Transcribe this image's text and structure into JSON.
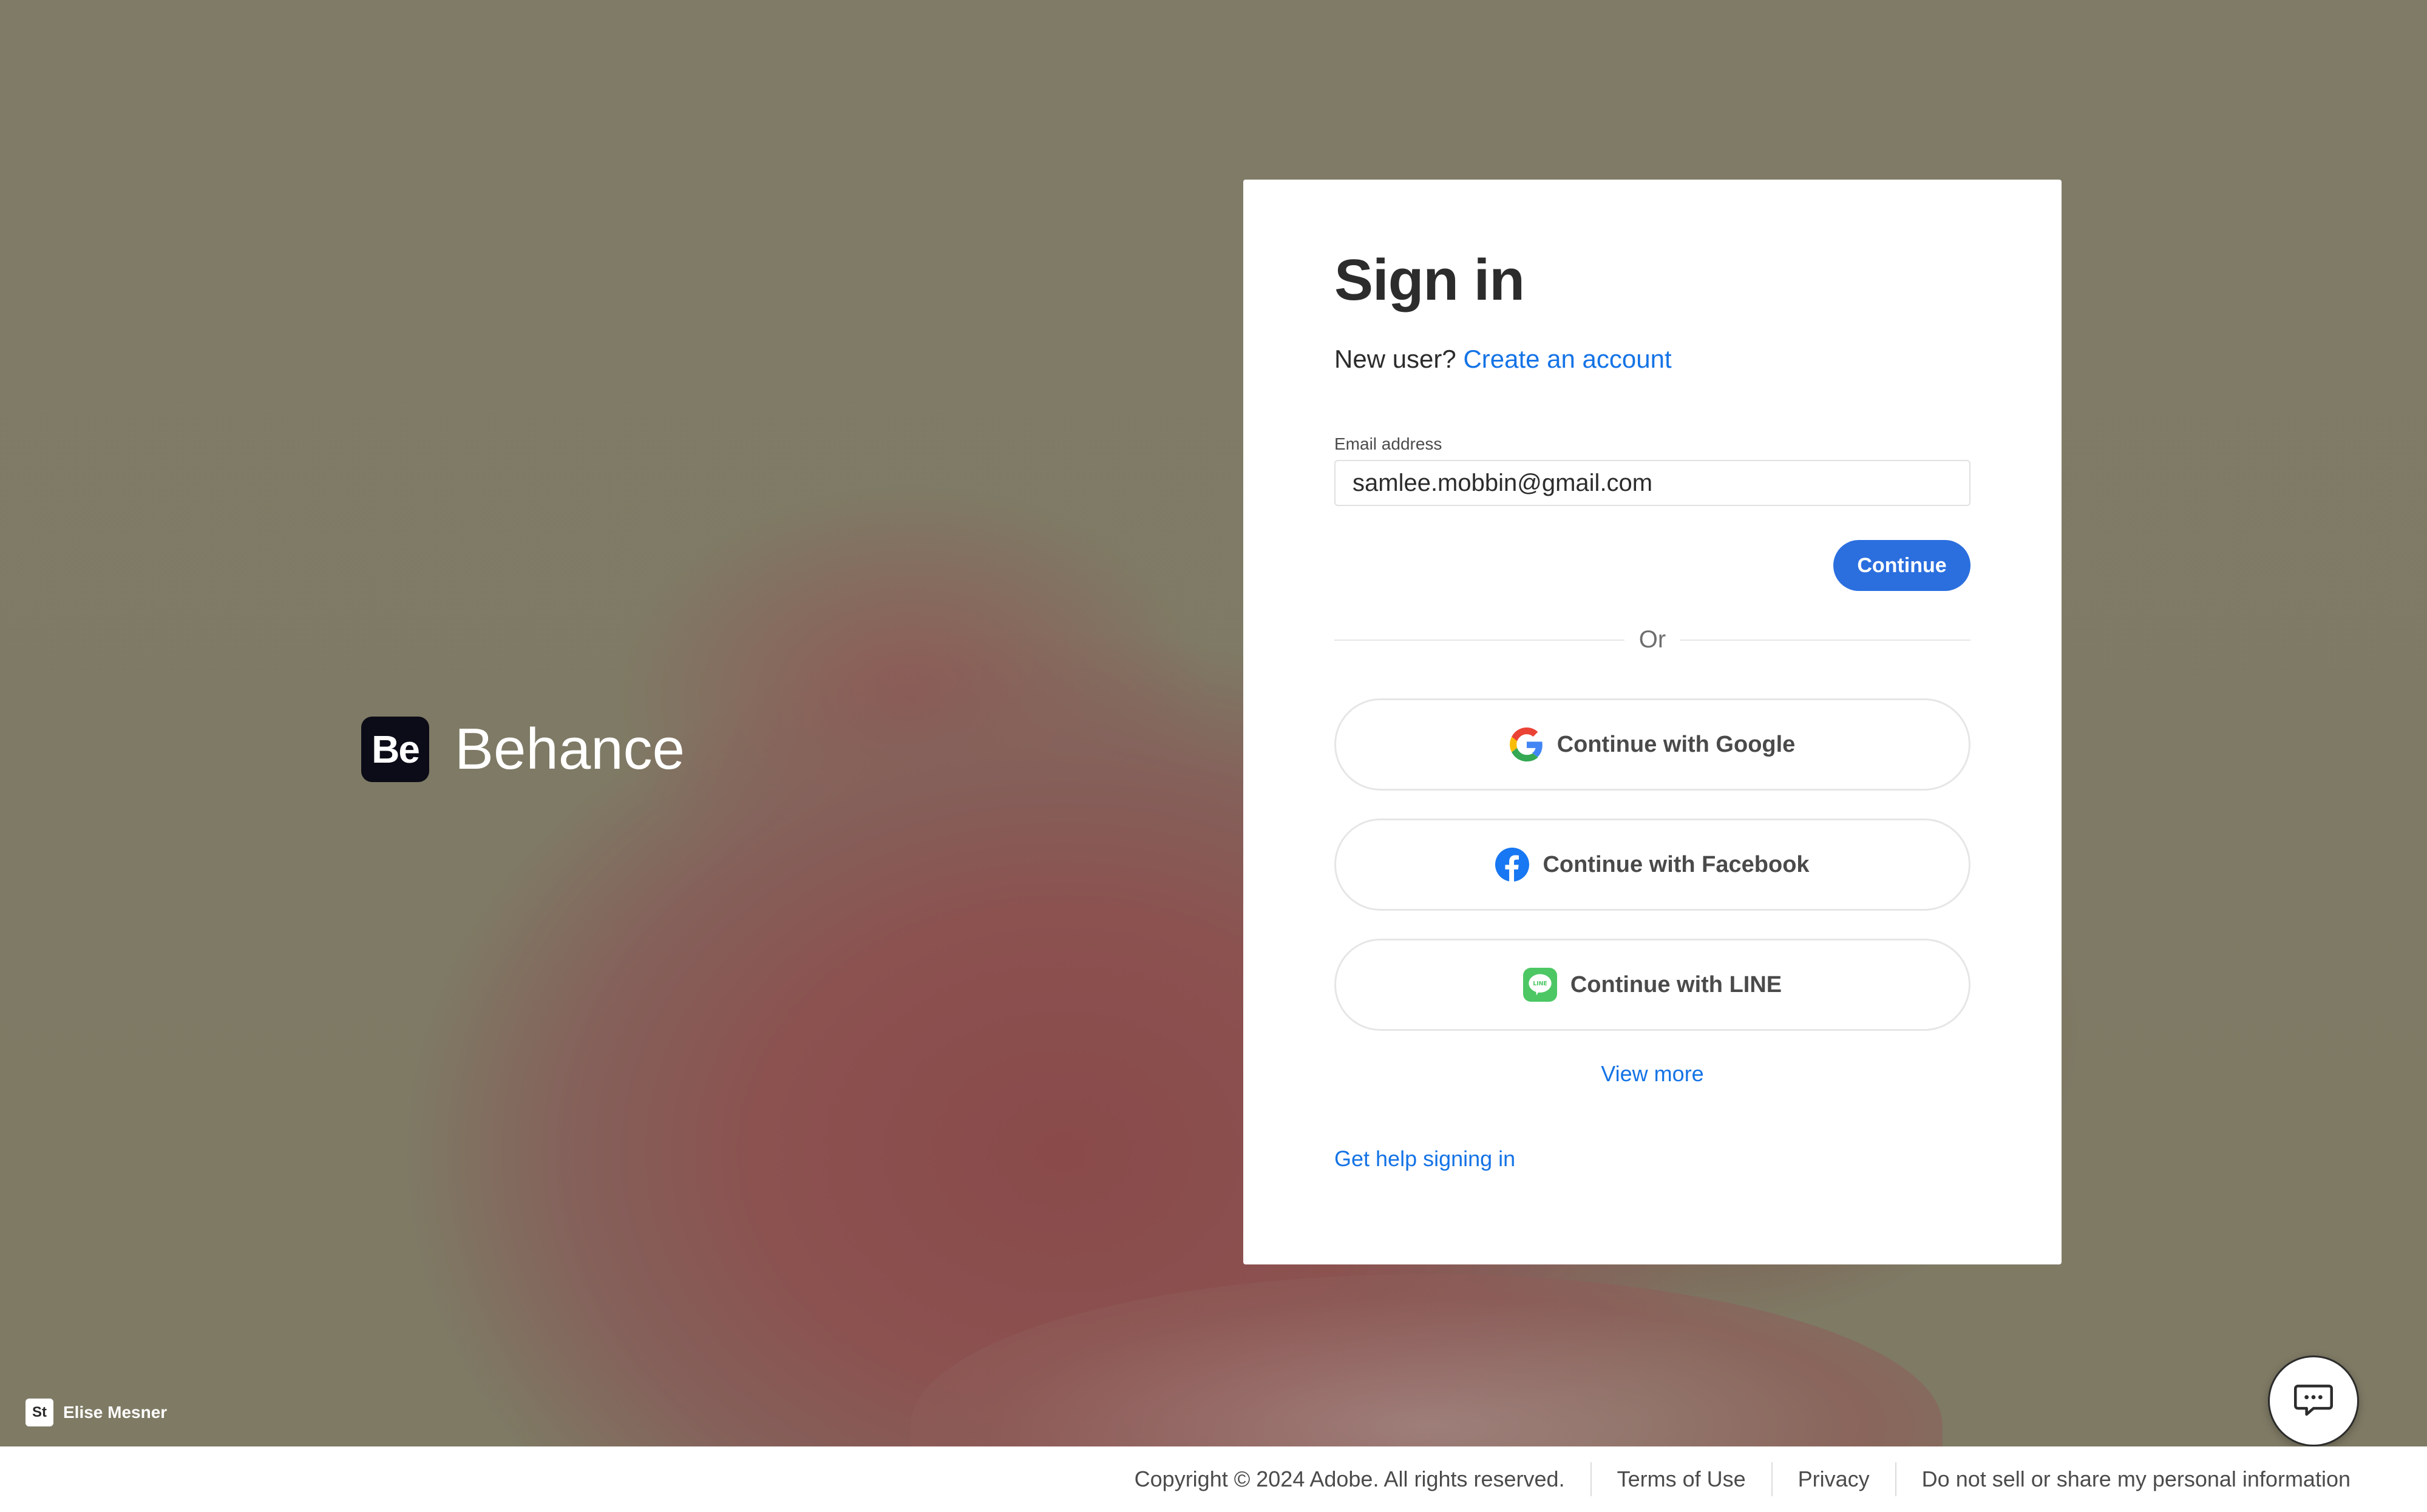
{
  "brand": {
    "logo_text": "Be",
    "name": "Behance"
  },
  "credit": {
    "badge": "St",
    "name": "Elise Mesner"
  },
  "signin": {
    "title": "Sign in",
    "new_user_text": "New user?",
    "create_account_link": "Create an account",
    "email_label": "Email address",
    "email_value": "samlee.mobbin@gmail.com",
    "continue_label": "Continue",
    "divider_text": "Or",
    "social_buttons": [
      {
        "label": "Continue with Google",
        "icon": "google-icon"
      },
      {
        "label": "Continue with Facebook",
        "icon": "facebook-icon"
      },
      {
        "label": "Continue with LINE",
        "icon": "line-icon"
      }
    ],
    "view_more": "View more",
    "help_link": "Get help signing in"
  },
  "chat": {
    "icon": "chat-bubble-icon"
  },
  "footer": {
    "copyright": "Copyright © 2024 Adobe. All rights reserved.",
    "terms": "Terms of Use",
    "privacy": "Privacy",
    "do_not_sell": "Do not sell or share my personal information"
  },
  "colors": {
    "accent": "#1473e6",
    "button_primary": "#2b6fdf",
    "background": "#7e7a65"
  }
}
